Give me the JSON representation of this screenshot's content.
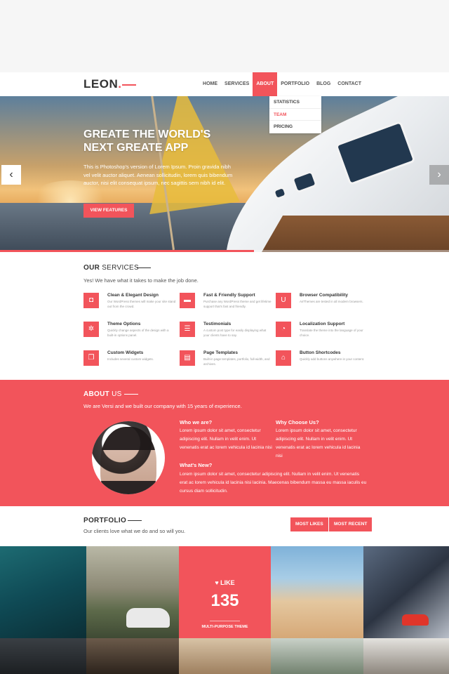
{
  "nav": {
    "logo": "LEON",
    "logo_dot": ".",
    "menu": [
      "HOME",
      "SERVICES",
      "ABOUT",
      "PORTFOLIO",
      "BLOG",
      "CONTACT"
    ],
    "active": "ABOUT",
    "dropdown": [
      "STATISTICS",
      "TEAM",
      "PRICING"
    ],
    "dropdown_active": "TEAM"
  },
  "hero": {
    "title_line1": "GREATE THE WORLD'S",
    "title_line2": "NEXT GREATE APP",
    "text": "This is Photoshop's version of Lorem Ipsum. Proin gravida nibh vel velit auctor aliquet. Aenean sollicitudin, lorem quis bibendum auctor, nisi elit consequat ipsum, nec sagittis sem nibh id elit.",
    "button": "VIEW FEATURES",
    "prev_glyph": "‹",
    "next_glyph": "›",
    "progress": 0.565
  },
  "services": {
    "title_bold": "OUR",
    "title_rest": " SERVICES",
    "subtitle": "Yes! We have what it takes to make the job done.",
    "items": [
      {
        "title": "Clean & Elegant Design",
        "desc": "Our WordPress themes will make your site stand out from the crowd.",
        "icon": "camera-icon",
        "glyph": "◘"
      },
      {
        "title": "Fast & Friendly Support",
        "desc": "Purchase any WordPress theme and get lifetime support that's fast and friendly.",
        "icon": "support-icon",
        "glyph": "▬"
      },
      {
        "title": "Browser Compatibility",
        "desc": "AirThemes are tested in all modern browsers.",
        "icon": "compatibility-icon",
        "glyph": "U"
      },
      {
        "title": "Theme Options",
        "desc": "Quickly change aspects of the design with a built-in options panel.",
        "icon": "gear-icon",
        "glyph": "✲"
      },
      {
        "title": "Testimonials",
        "desc": "A custom post type for easily displaying what your clients have to say.",
        "icon": "chat-icon",
        "glyph": "☰"
      },
      {
        "title": "Localization Support",
        "desc": "Translate the theme into the language of your choice.",
        "icon": "clock-icon",
        "glyph": "◔"
      },
      {
        "title": "Custom Widgets",
        "desc": "Includes several custom widgets.",
        "icon": "widgets-icon",
        "glyph": "❐"
      },
      {
        "title": "Page Templates",
        "desc": "Built-in page templates, portfolio, full-width, and archives.",
        "icon": "template-icon",
        "glyph": "▤"
      },
      {
        "title": "Button Shortcodes",
        "desc": "Quickly add buttons anywhere in your content.",
        "icon": "home-icon",
        "glyph": "⌂"
      }
    ]
  },
  "about": {
    "title_bold": "ABOUT",
    "title_rest": " US",
    "subtitle": "We are Versi and we built our company with 15 years of experience.",
    "who_title": "Who we are?",
    "who_text": "Lorem ipsum dolor sit amet, consectetur adipiscing elit. Nullam in velit enim. Ut venenatis erat ac lorem vehicula id lacinia nisi",
    "why_title": "Why Choose Us?",
    "why_text": "Lorem ipsum dolor sit amet, consectetur adipiscing elit. Nullam in velit enim. Ut venenatis erat ac lorem vehicula id lacinia nisi",
    "new_title": "What's New?",
    "new_text": "Lorem ipsum dolor sit amet, consectetur adipiscing elit. Nullam in velit enim. Ut venenatis erat ac lorem vehicula id lacinia nisi laciniа. Maecenas bibendum massa eu massa iaculis eu cursus diam sollicitudin."
  },
  "portfolio": {
    "title": "PORTFOLIO",
    "subtitle": "Our clients love what we do and so will you.",
    "btn_most_likes": "MOST LIKES",
    "btn_most_recent": "MOST RECENT",
    "like_label": "♥ LIKE",
    "like_count": "135",
    "like_caption": "MULTI-PURPOSE THEME"
  },
  "colors": {
    "accent": "#f2545b"
  }
}
